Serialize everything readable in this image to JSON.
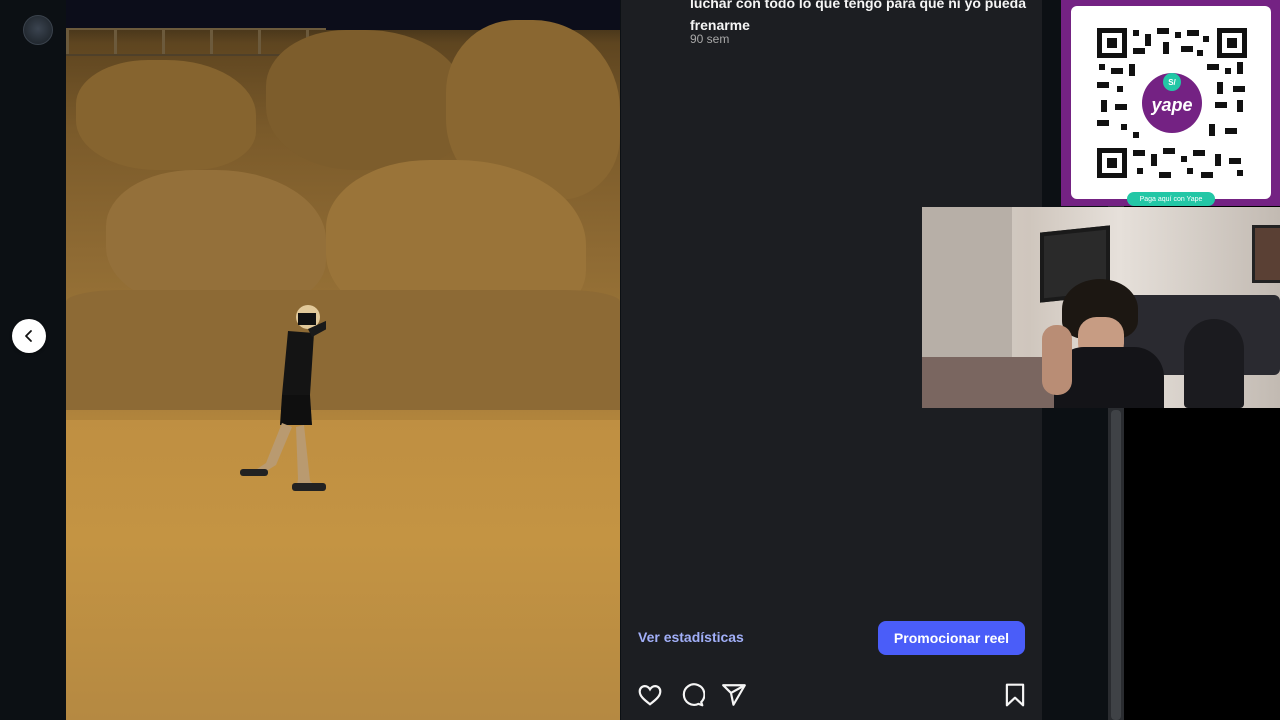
{
  "caption": {
    "text": "luchar con todo lo que tengo para que ni yo pueda frenarme",
    "time": "90 sem"
  },
  "actions": {
    "stats_label": "Ver estadísticas",
    "promote_label": "Promocionar reel"
  },
  "overlay": {
    "qr_brand": "yape",
    "qr_currency": "S/",
    "qr_cta": "Paga aquí con Yape"
  },
  "colors": {
    "promote_button": "#4a5df9",
    "stats_link": "#a1aff8",
    "yape_purple": "#742283",
    "yape_green": "#23c7a6"
  },
  "icons": [
    "chevron-left-icon",
    "heart-icon",
    "comment-icon",
    "share-icon",
    "bookmark-icon"
  ]
}
